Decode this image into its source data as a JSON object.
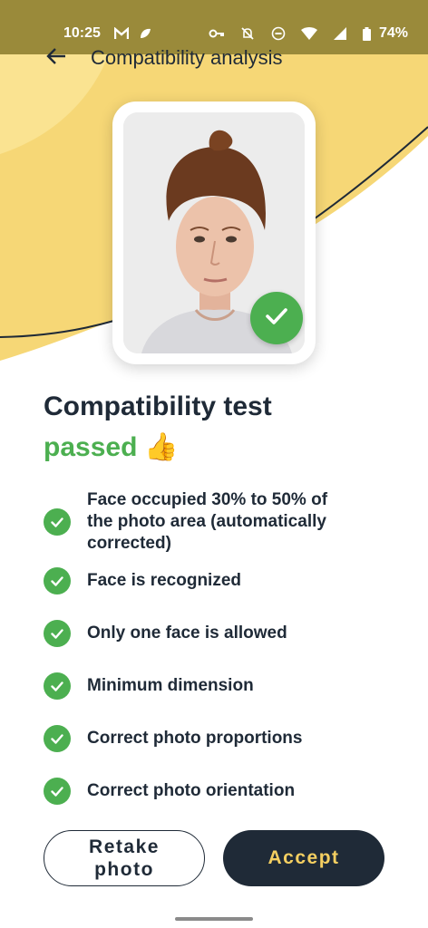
{
  "status_bar": {
    "time": "10:25",
    "battery": "74%",
    "icons": [
      "gmail-icon",
      "app-notification-icon",
      "vpn-key-icon",
      "mute-icon",
      "dnd-icon",
      "wifi-icon",
      "signal-icon",
      "battery-icon"
    ]
  },
  "app_bar": {
    "title": "Compatibility analysis",
    "back_icon": "arrow-left-icon"
  },
  "result": {
    "title": "Compatibility test",
    "status": "passed",
    "emoji": "👍"
  },
  "checks": [
    {
      "label": "Face occupied 30% to 50% of the photo area (automatically corrected)"
    },
    {
      "label": "Face is recognized"
    },
    {
      "label": "Only one face is allowed"
    },
    {
      "label": "Minimum dimension"
    },
    {
      "label": "Correct photo proportions"
    },
    {
      "label": "Correct photo orientation"
    }
  ],
  "buttons": {
    "retake": "Retake photo",
    "accept": "Accept"
  },
  "colors": {
    "accent_yellow": "#f6d776",
    "success_green": "#4caf50",
    "dark_navy": "#1f2a37",
    "status_bar_bg": "#9a8a3a"
  }
}
